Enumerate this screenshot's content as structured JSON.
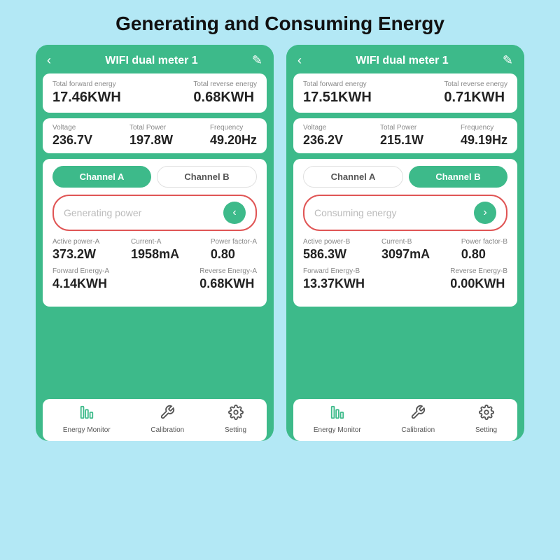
{
  "page": {
    "title": "Generating and Consuming Energy",
    "background": "#b3e8f5"
  },
  "phone_left": {
    "header": {
      "title": "WIFI dual meter 1",
      "back_label": "‹",
      "edit_label": "✎"
    },
    "total_forward_energy_label": "Total  forward energy",
    "total_forward_energy_value": "17.46KWH",
    "total_reverse_energy_label": "Total reverse energy",
    "total_reverse_energy_value": "0.68KWH",
    "voltage_label": "Voltage",
    "voltage_value": "236.7V",
    "total_power_label": "Total Power",
    "total_power_value": "197.8W",
    "frequency_label": "Frequency",
    "frequency_value": "49.20Hz",
    "channel_a_label": "Channel A",
    "channel_b_label": "Channel B",
    "channel_a_active": true,
    "status_text": "Generating power",
    "nav_icon": "‹",
    "active_power_label": "Active power-A",
    "active_power_value": "373.2W",
    "current_label": "Current-A",
    "current_value": "1958mA",
    "power_factor_label": "Power factor-A",
    "power_factor_value": "0.80",
    "forward_energy_label": "Forward Energy-A",
    "forward_energy_value": "4.14KWH",
    "reverse_energy_label": "Reverse Energy-A",
    "reverse_energy_value": "0.68KWH",
    "bottom_nav": [
      {
        "label": "Energy Monitor",
        "icon": "chart",
        "active": true
      },
      {
        "label": "Calibration",
        "icon": "wrench",
        "active": false
      },
      {
        "label": "Setting",
        "icon": "gear",
        "active": false
      }
    ]
  },
  "phone_right": {
    "header": {
      "title": "WIFI dual meter 1",
      "back_label": "‹",
      "edit_label": "✎"
    },
    "total_forward_energy_label": "Total  forward energy",
    "total_forward_energy_value": "17.51KWH",
    "total_reverse_energy_label": "Total reverse energy",
    "total_reverse_energy_value": "0.71KWH",
    "voltage_label": "Voltage",
    "voltage_value": "236.2V",
    "total_power_label": "Total Power",
    "total_power_value": "215.1W",
    "frequency_label": "Frequency",
    "frequency_value": "49.19Hz",
    "channel_a_label": "Channel A",
    "channel_b_label": "Channel B",
    "channel_b_active": true,
    "status_text": "Consuming energy",
    "nav_icon": "›",
    "active_power_label": "Active power-B",
    "active_power_value": "586.3W",
    "current_label": "Current-B",
    "current_value": "3097mA",
    "power_factor_label": "Power factor-B",
    "power_factor_value": "0.80",
    "forward_energy_label": "Forward Energy-B",
    "forward_energy_value": "13.37KWH",
    "reverse_energy_label": "Reverse Energy-B",
    "reverse_energy_value": "0.00KWH",
    "bottom_nav": [
      {
        "label": "Energy Monitor",
        "icon": "chart",
        "active": true
      },
      {
        "label": "Calibration",
        "icon": "wrench",
        "active": false
      },
      {
        "label": "Setting",
        "icon": "gear",
        "active": false
      }
    ]
  }
}
